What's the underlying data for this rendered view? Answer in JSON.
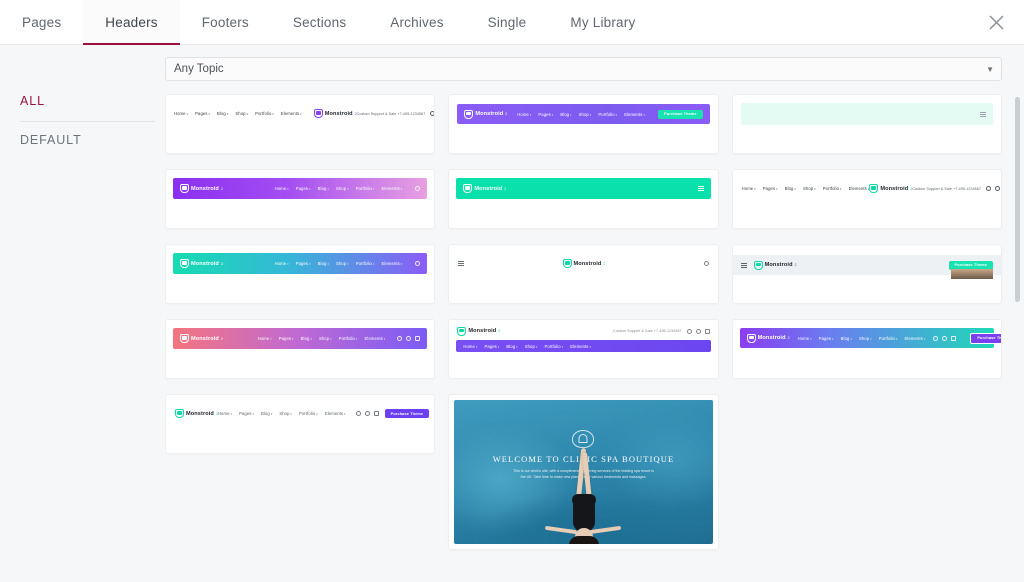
{
  "window": {
    "close_label": "×"
  },
  "tabs": [
    {
      "label": "Pages",
      "active": false
    },
    {
      "label": "Headers",
      "active": true
    },
    {
      "label": "Footers",
      "active": false
    },
    {
      "label": "Sections",
      "active": false
    },
    {
      "label": "Archives",
      "active": false
    },
    {
      "label": "Single",
      "active": false
    },
    {
      "label": "My Library",
      "active": false
    }
  ],
  "sidebar": {
    "items": [
      {
        "label": "ALL",
        "active": true
      },
      {
        "label": "DEFAULT",
        "active": false
      }
    ]
  },
  "filter": {
    "topic_label": "Any Topic",
    "caret": "▼"
  },
  "brand": {
    "name": "Monstroid",
    "sup": "2",
    "logo_icon": "shield-logo-icon"
  },
  "nav_items": [
    "Home",
    "Pages",
    "Blog",
    "Shop",
    "Portfolio",
    "Elements"
  ],
  "nav_items_short": [
    "Home",
    "Pages",
    "Blog",
    "Shop",
    "Portfolio",
    "Elements"
  ],
  "support_text": "Custom Support & Sale +7-495-1234567",
  "cta": {
    "purchase": "Purchase Theme"
  },
  "colors": {
    "accent": "#9c123f",
    "purple": "#8b5cf6",
    "teal": "#09e0ac",
    "mint_bg": "#e4fbf3",
    "cta_teal": "#19e3b1",
    "cta_purple": "#6b3ff2"
  },
  "cards": [
    {
      "name": "header-template-1",
      "theme": "light-nav-left-logo-center"
    },
    {
      "name": "header-template-2",
      "theme": "purple-gradient-cta"
    },
    {
      "name": "header-template-3",
      "theme": "mint-minimal-burger"
    },
    {
      "name": "header-template-4",
      "theme": "purple-pink-gradient"
    },
    {
      "name": "header-template-5",
      "theme": "teal-solid-burger"
    },
    {
      "name": "header-template-6",
      "theme": "white-centered-logo-social"
    },
    {
      "name": "header-template-7",
      "theme": "teal-purple-gradient"
    },
    {
      "name": "header-template-8",
      "theme": "white-centered-minimal"
    },
    {
      "name": "header-template-9",
      "theme": "grey-bar-cta-photo"
    },
    {
      "name": "header-template-10",
      "theme": "coral-purple-gradient"
    },
    {
      "name": "header-template-11",
      "theme": "two-row-purple-navbar"
    },
    {
      "name": "header-template-12",
      "theme": "purple-teal-gradient-cta"
    },
    {
      "name": "header-template-13",
      "theme": "white-nav-purple-cta"
    },
    {
      "name": "header-template-14",
      "theme": "spa-hero-photo"
    }
  ],
  "hero": {
    "title": "WELCOME TO CLINIC SPA BOUTIQUE",
    "body": "This is our clinic's site, with a complimentary offering services of the leading spa resort in the UK. Take time to make new plans, enjoy various treatments and massages."
  }
}
